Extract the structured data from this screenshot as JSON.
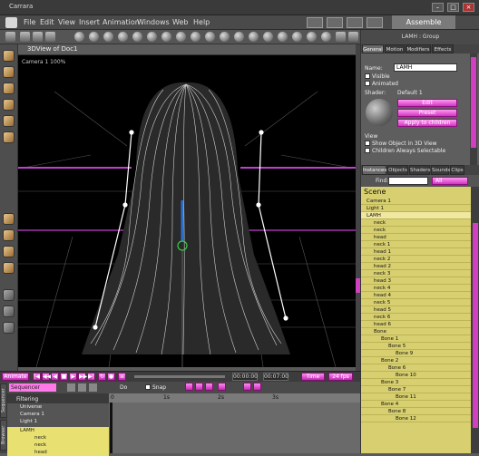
{
  "window": {
    "title": "Carrara"
  },
  "menu": [
    "File",
    "Edit",
    "View",
    "Insert",
    "Animation",
    "Windows",
    "Web",
    "Help"
  ],
  "room": {
    "label": "Assemble"
  },
  "view": {
    "title": "3DView of Doc1",
    "camera_label": "Camera 1 100%"
  },
  "timeline": {
    "animate_label": "Animate",
    "time_start": "00:00:00",
    "time_end": "00:07:00",
    "time_label": "Time",
    "fps": "24 fps"
  },
  "sequencer": {
    "mode": "Sequencer",
    "do_label": "Do",
    "snap_label": "Snap",
    "filtering_label": "Filtering",
    "tabs": [
      "Sequencer",
      "Browser"
    ],
    "ruler": [
      "0",
      "1s",
      "2s",
      "3s"
    ],
    "items": [
      {
        "label": "Universe",
        "style": "plain"
      },
      {
        "label": "Camera 1",
        "style": "plain"
      },
      {
        "label": "Light 1",
        "style": "plain"
      },
      {
        "label": "LAMH",
        "style": "y"
      },
      {
        "label": "neck",
        "style": "y"
      },
      {
        "label": "neck",
        "style": "y"
      },
      {
        "label": "head",
        "style": "y"
      }
    ]
  },
  "panel": {
    "title": "LAMH : Group",
    "tabs": [
      "General",
      "Motion",
      "Modifiers",
      "Effects"
    ],
    "name_label": "Name:",
    "name_value": "LAMH",
    "visible_label": "Visible",
    "animated_label": "Animated",
    "shader_label": "Shader:",
    "shader_value": "Default 1",
    "edit_label": "Edit",
    "preset_label": "Preset",
    "apply_label": "Apply to children",
    "view_section": "View",
    "show_label": "Show Object in 3D View",
    "children_label": "Children Always Selectable"
  },
  "instances": {
    "tabs": [
      "Instances",
      "Objects",
      "Shaders",
      "Sounds",
      "Clips"
    ],
    "find_label": "Find:",
    "find_scope": "All",
    "scene_label": "Scene",
    "items": [
      {
        "label": "Camera 1",
        "indent": 0
      },
      {
        "label": "Light 1",
        "indent": 0
      },
      {
        "label": "LAMH",
        "indent": 0
      },
      {
        "label": "neck",
        "indent": 1
      },
      {
        "label": "neck",
        "indent": 1
      },
      {
        "label": "head",
        "indent": 1
      },
      {
        "label": "neck 1",
        "indent": 1
      },
      {
        "label": "head 1",
        "indent": 1
      },
      {
        "label": "neck 2",
        "indent": 1
      },
      {
        "label": "head 2",
        "indent": 1
      },
      {
        "label": "neck 3",
        "indent": 1
      },
      {
        "label": "head 3",
        "indent": 1
      },
      {
        "label": "neck 4",
        "indent": 1
      },
      {
        "label": "head 4",
        "indent": 1
      },
      {
        "label": "neck 5",
        "indent": 1
      },
      {
        "label": "head 5",
        "indent": 1
      },
      {
        "label": "neck 6",
        "indent": 1
      },
      {
        "label": "head 6",
        "indent": 1
      },
      {
        "label": "Bone",
        "indent": 1
      },
      {
        "label": "Bone 1",
        "indent": 2
      },
      {
        "label": "Bone 5",
        "indent": 3
      },
      {
        "label": "Bone 9",
        "indent": 4
      },
      {
        "label": "Bone 2",
        "indent": 2
      },
      {
        "label": "Bone 6",
        "indent": 3
      },
      {
        "label": "Bone 10",
        "indent": 4
      },
      {
        "label": "Bone 3",
        "indent": 2
      },
      {
        "label": "Bone 7",
        "indent": 3
      },
      {
        "label": "Bone 11",
        "indent": 4
      },
      {
        "label": "Bone 4",
        "indent": 2
      },
      {
        "label": "Bone 8",
        "indent": 3
      },
      {
        "label": "Bone 12",
        "indent": 4
      }
    ]
  },
  "colors": {
    "accent": "#d040c0",
    "tree_bg": "#d8d070",
    "grid_pink": "#c040d0"
  }
}
